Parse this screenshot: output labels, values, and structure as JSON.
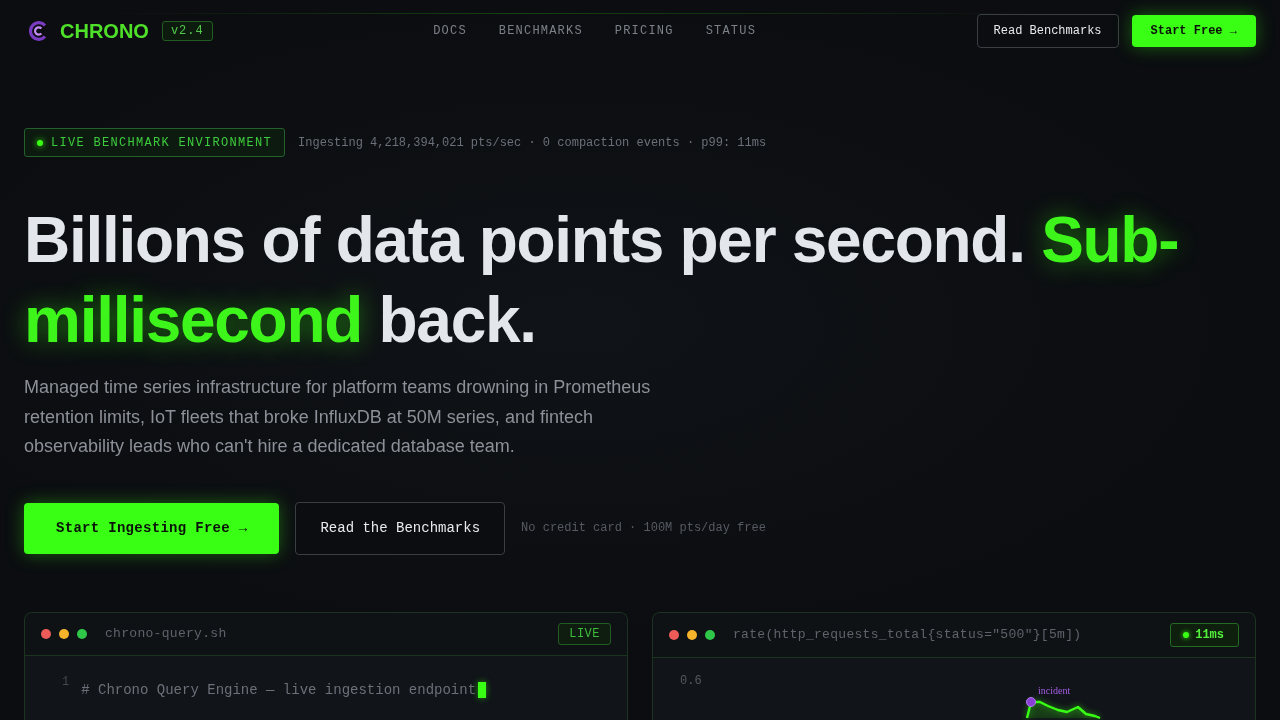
{
  "nav": {
    "logo": "CHRONO",
    "version": "v2.4",
    "links": [
      "DOCS",
      "BENCHMARKS",
      "PRICING",
      "STATUS"
    ],
    "buttons": [
      {
        "label": "Read Benchmarks",
        "kind": "secondary"
      },
      {
        "label": "Start Free →",
        "kind": "primary"
      }
    ]
  },
  "hero": {
    "badge": "LIVE BENCHMARK ENVIRONMENT",
    "stats": "Ingesting 4,218,394,021 pts/sec · 0 compaction events · p99: 11ms",
    "headline": [
      {
        "text": "Billions of data points per second. ",
        "accent": false
      },
      {
        "text": "Sub-millisecond",
        "accent": true
      },
      {
        "text": " back.",
        "accent": false
      }
    ],
    "subtitle": "Managed time series infrastructure for platform teams drowning in Prometheus retention limits, IoT fleets that broke InfluxDB at 50M series, and fintech observability leads who can't hire a dedicated database team.",
    "buttons": [
      {
        "label": "Start Ingesting Free →",
        "kind": "primary"
      },
      {
        "label": "Read the Benchmarks",
        "kind": "secondary"
      }
    ],
    "note": "No credit card · 100M pts/day free"
  },
  "panels": [
    {
      "kind": "code",
      "title": "chrono-query.sh",
      "badge": "LIVE",
      "lines": [
        {
          "number": "1",
          "text": "# Chrono Query Engine — live ingestion endpoint"
        }
      ]
    },
    {
      "kind": "chart",
      "title": "rate(http_requests_total{status=\"500\"}[5m])",
      "badge": "11ms",
      "y_tick": "0.6",
      "annotation": "incident"
    }
  ]
}
